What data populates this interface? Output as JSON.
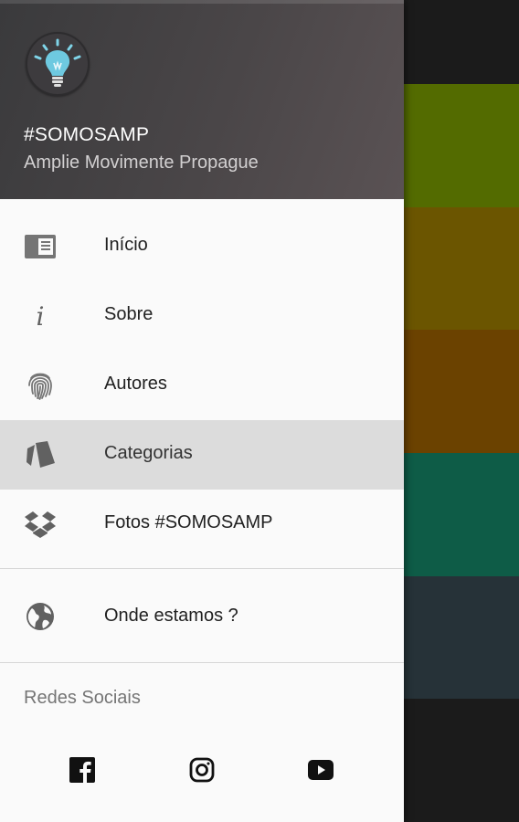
{
  "background": {
    "tile_colors": [
      "#536b00",
      "#6b5500",
      "#6b4200",
      "#0e5c47",
      "#263238"
    ]
  },
  "drawer": {
    "header": {
      "avatar_icon": "lightbulb-icon",
      "title": "#SOMOSAMP",
      "subtitle": "Amplie Movimente Propague"
    },
    "menu": [
      {
        "label": "Início",
        "icon": "newspaper-icon",
        "selected": false
      },
      {
        "label": "Sobre",
        "icon": "info-icon",
        "selected": false
      },
      {
        "label": "Autores",
        "icon": "fingerprint-icon",
        "selected": false
      },
      {
        "label": "Categorias",
        "icon": "tag-icon",
        "selected": true
      },
      {
        "label": "Fotos #SOMOSAMP",
        "icon": "dropbox-icon",
        "selected": false
      }
    ],
    "location": {
      "label": "Onde estamos ?",
      "icon": "globe-icon"
    },
    "social_section": {
      "label": "Redes Sociais",
      "links": [
        "facebook-icon",
        "instagram-icon",
        "youtube-icon"
      ]
    }
  }
}
